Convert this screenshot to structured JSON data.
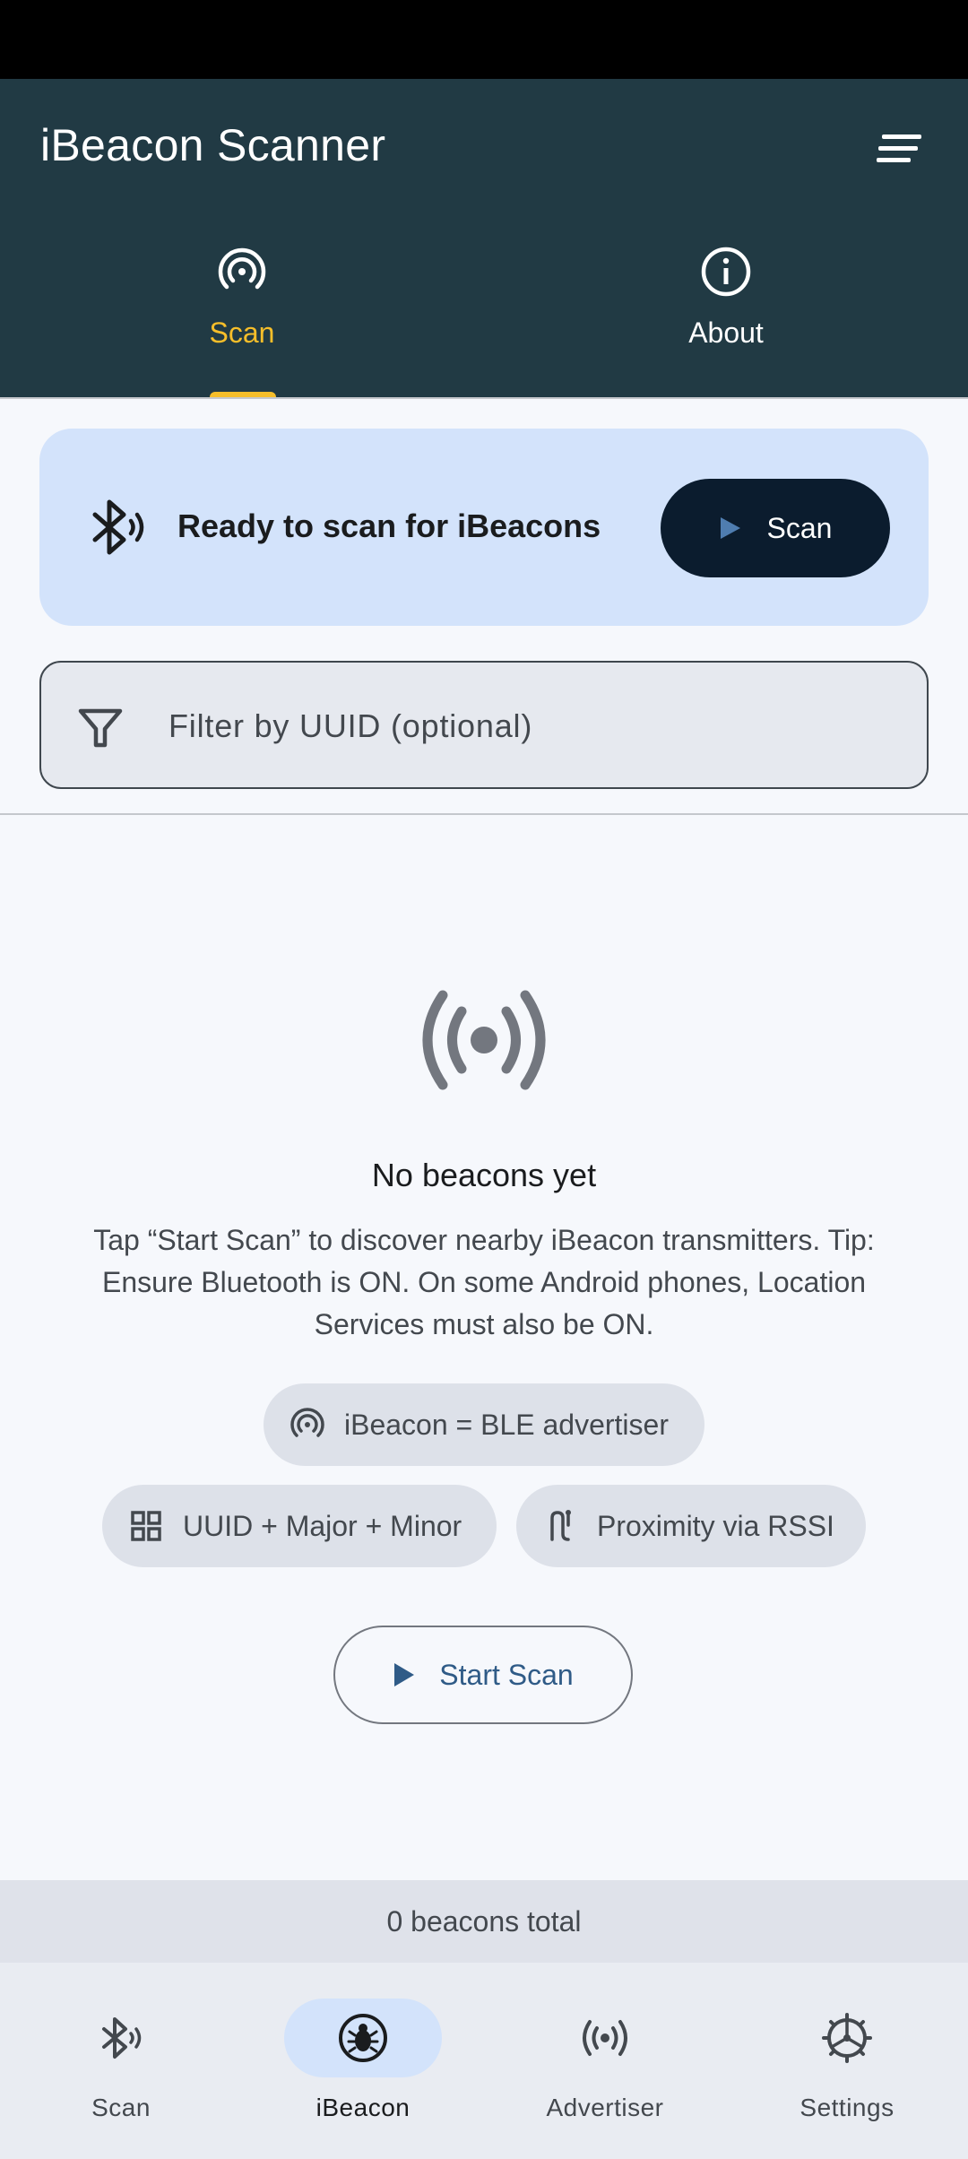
{
  "app": {
    "title": "iBeacon Scanner",
    "menu_icon": "sort-menu-icon"
  },
  "tabs": [
    {
      "label": "Scan",
      "icon": "radar-icon",
      "selected": true
    },
    {
      "label": "About",
      "icon": "info-icon",
      "selected": false
    }
  ],
  "status_card": {
    "icon": "bluetooth-searching-icon",
    "text": "Ready to scan for iBeacons",
    "button_label": "Scan",
    "button_icon": "play-icon"
  },
  "filter": {
    "icon": "filter-icon",
    "placeholder": "Filter by UUID (optional)",
    "value": ""
  },
  "empty_state": {
    "icon": "broadcast-icon",
    "title": "No beacons yet",
    "description": "Tap “Start Scan” to discover nearby iBeacon transmitters. Tip: Ensure Bluetooth is ON. On some Android phones, Location Services must also be ON.",
    "chips": [
      {
        "label": "iBeacon = BLE advertiser",
        "icon": "radar-icon"
      },
      {
        "label": "UUID + Major + Minor",
        "icon": "grid-icon"
      },
      {
        "label": "Proximity via RSSI",
        "icon": "route-icon"
      }
    ],
    "start_button": {
      "label": "Start Scan",
      "icon": "play-icon"
    }
  },
  "total_text": "0 beacons total",
  "bottom_nav": [
    {
      "label": "Scan",
      "icon": "bluetooth-scan-icon",
      "active": false
    },
    {
      "label": "iBeacon",
      "icon": "beacon-bug-icon",
      "active": true
    },
    {
      "label": "Advertiser",
      "icon": "broadcast-icon",
      "active": false
    },
    {
      "label": "Settings",
      "icon": "gear-icon",
      "active": false
    }
  ],
  "colors": {
    "app_bar": "#213a44",
    "accent": "#f6be2a",
    "card": "#d3e3fb",
    "primary_button": "#0b1c2e"
  }
}
